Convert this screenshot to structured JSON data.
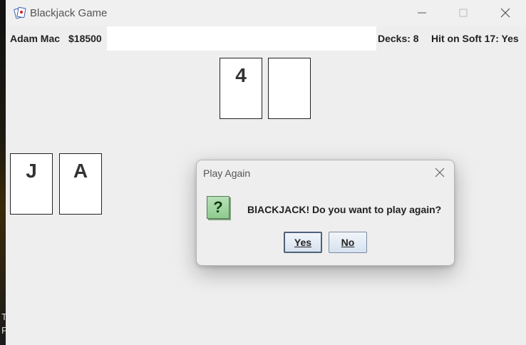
{
  "window": {
    "title": "Blackjack Game"
  },
  "infobar": {
    "player_name": "Adam Mac",
    "money": "$18500",
    "message": "",
    "decks": "Decks: 8",
    "soft17": "Hit on Soft 17: Yes"
  },
  "dealer": {
    "cards": [
      {
        "rank": "4"
      },
      {
        "rank": ""
      }
    ]
  },
  "player": {
    "cards": [
      {
        "rank": "J"
      },
      {
        "rank": "A"
      }
    ]
  },
  "dialog": {
    "title": "Play Again",
    "message": "BlACKJACK! Do you want to play again?",
    "yes_label": "Yes",
    "no_label": "No"
  },
  "desktop": {
    "edge_text_1": "T",
    "edge_text_2": "F"
  },
  "colors": {
    "window_bg": "#eeeeee",
    "card_bg": "#ffffff",
    "question_icon_bg": "#8fcb8f"
  }
}
